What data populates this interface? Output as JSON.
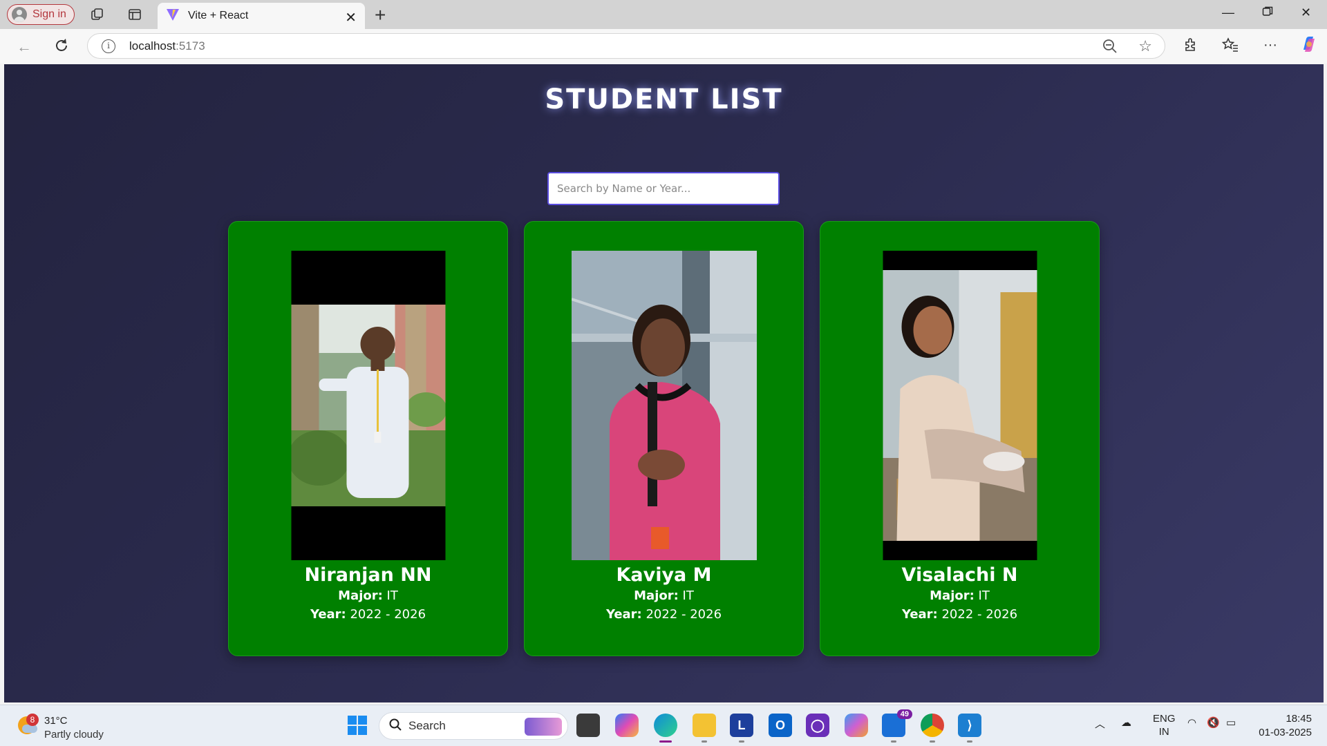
{
  "browser": {
    "sign_in_label": "Sign in",
    "tab_title": "Vite + React",
    "url_host": "localhost",
    "url_port": ":5173"
  },
  "page": {
    "title": "STUDENT LIST",
    "search_placeholder": "Search by Name or Year...",
    "major_label": "Major:",
    "year_label": "Year:",
    "card_color": "#008000",
    "students": [
      {
        "name": "Niranjan NN",
        "major": "IT",
        "year": "2022 - 2026"
      },
      {
        "name": "Kaviya M",
        "major": "IT",
        "year": "2022 - 2026"
      },
      {
        "name": "Visalachi N",
        "major": "IT",
        "year": "2022 - 2026"
      }
    ]
  },
  "taskbar": {
    "weather_badge": "8",
    "temperature": "31°C",
    "condition": "Partly cloudy",
    "search_label": "Search",
    "store_badge": "49",
    "lang_top": "ENG",
    "lang_bottom": "IN",
    "time": "18:45",
    "date": "01-03-2025"
  }
}
